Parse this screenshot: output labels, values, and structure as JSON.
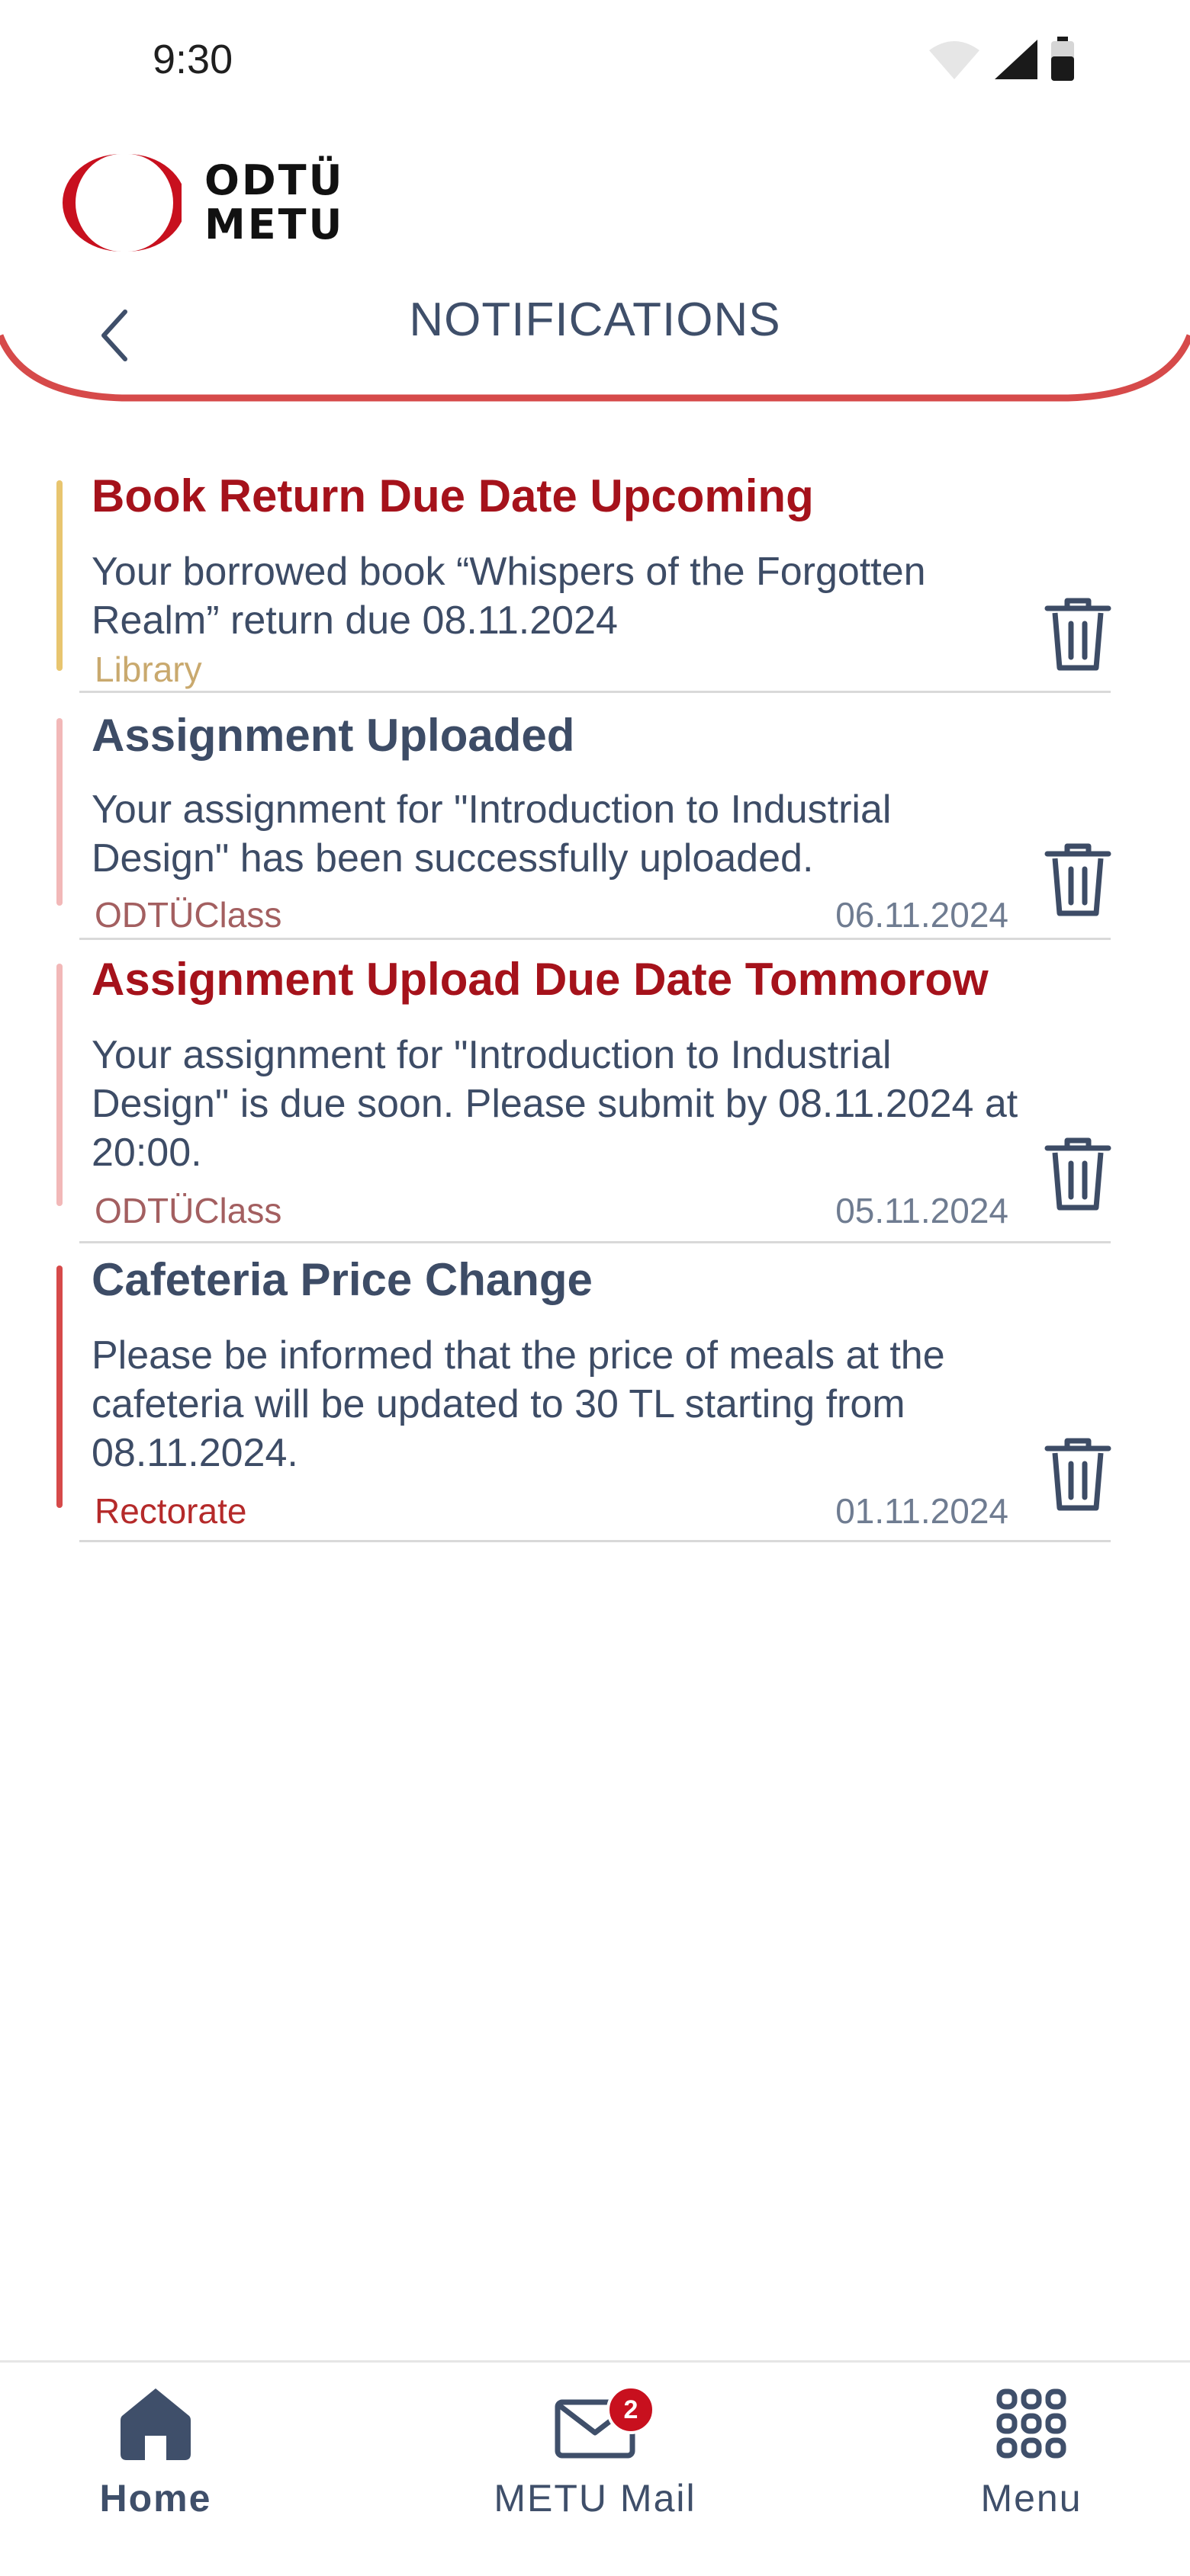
{
  "status_bar": {
    "time": "9:30"
  },
  "header": {
    "logo_line1": "ODTÜ",
    "logo_line2": "METU",
    "title": "NOTIFICATIONS"
  },
  "colors": {
    "brand_red": "#c8101e",
    "title_red": "#a5121b",
    "text_slate": "#3f4f6a",
    "library_accent": "#e8c56f",
    "odtuclass_accent": "#f2b8b8",
    "rectorate_accent": "#d64a4a"
  },
  "notifications": [
    {
      "title": "Book Return Due Date Upcoming",
      "body": "Your borrowed book “Whispers of the Forgotten Realm” return due 08.11.2024",
      "source": "Library",
      "date": ""
    },
    {
      "title": "Assignment Uploaded",
      "body": "Your assignment for \"Introduction to Industrial Design\" has been successfully uploaded.",
      "source": "ODTÜClass",
      "date": "06.11.2024"
    },
    {
      "title": "Assignment Upload Due Date Tommorow",
      "body": "Your assignment for \"Introduction to Industrial Design\" is due soon. Please submit by 08.11.2024 at 20:00.",
      "source": "ODTÜClass",
      "date": "05.11.2024"
    },
    {
      "title": "Cafeteria Price Change",
      "body": "Please be informed that the price of meals at the cafeteria will be updated to 30 TL starting from 08.11.2024.",
      "source": "Rectorate",
      "date": "01.11.2024"
    }
  ],
  "bottom_nav": {
    "home": "Home",
    "mail": "METU Mail",
    "mail_badge": "2",
    "menu": "Menu"
  }
}
